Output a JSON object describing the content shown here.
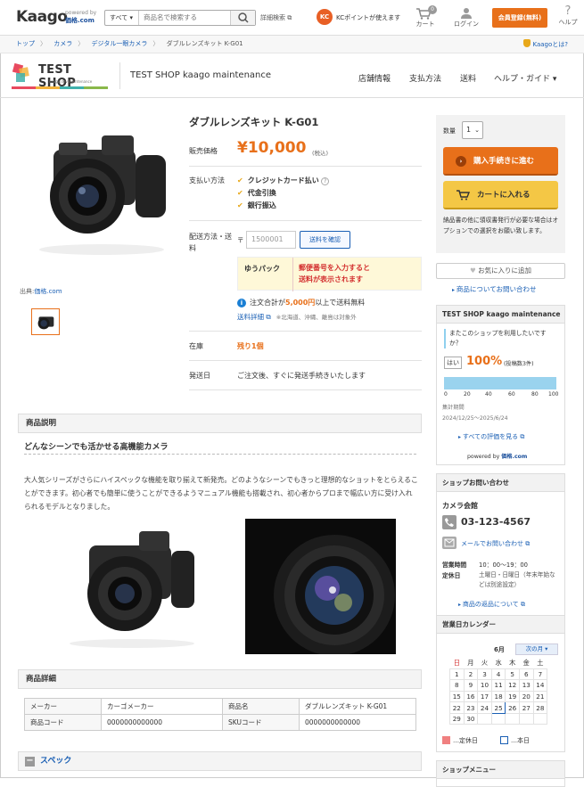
{
  "header": {
    "logo": "Kaago",
    "logo_powered": "powered by",
    "logo_brand": "価格.com",
    "search_category": "すべて ▾",
    "search_placeholder": "商品名で検索する",
    "advanced_search": "詳細検索",
    "kc_icon": "KC",
    "kc_points": "KCポイントが使えます",
    "cart_label": "カート",
    "cart_count": "0",
    "login_label": "ログイン",
    "register_label": "会員登録(無料)",
    "help_label": "ヘルプ"
  },
  "breadcrumb": [
    "トップ",
    "カメラ",
    "デジタル一眼カメラ",
    "ダブルレンズキット K-G01"
  ],
  "breadcrumb_sep": "〉",
  "kaago_about": "Kaagoとは?",
  "shop": {
    "logo_name": "TEST SHOP",
    "logo_sub": "kaago.dev maintenance",
    "name": "TEST SHOP kaago maintenance",
    "nav": [
      "店舗情報",
      "支払方法",
      "送料",
      "ヘルプ・ガイド ▾"
    ]
  },
  "product": {
    "title": "ダブルレンズキット K-G01",
    "price_label": "販売価格",
    "price": "¥10,000",
    "tax": "(税込)",
    "payment_label": "支払い方法",
    "payments": [
      "クレジットカード払い",
      "代金引換",
      "銀行振込"
    ],
    "shipping_label": "配送方法・送料",
    "zip_mark": "〒",
    "zip_placeholder": "1500001",
    "zip_button": "送料を確認",
    "carrier": "ゆうパック",
    "carrier_note_1": "郵便番号を入力すると",
    "carrier_note_2": "送料が表示されます",
    "free_notice_pre": "注文合計が",
    "free_notice_amount": "5,000円",
    "free_notice_post": "以上で送料無料",
    "shipping_detail": "送料詳細",
    "shipping_detail_note": "※北海道、沖縄、離島は対象外",
    "stock_label": "在庫",
    "stock_value": "残り1個",
    "ship_date_label": "発送日",
    "ship_date_value": "ご注文後、すぐに発送手続きいたします",
    "source_label": "出典:",
    "source_link": "価格.com"
  },
  "purchase": {
    "qty_label": "数量",
    "qty_value": "1",
    "buy_button": "購入手続きに進む",
    "cart_button": "カートに入れる",
    "note": "納品書の他に領収書発行が必要な場合はオプションでの選択をお願い致します。",
    "favorite": "お気に入りに追加",
    "inquiry": "商品についてお問い合わせ"
  },
  "rating": {
    "shop": "TEST SHOP kaago maintenance",
    "question": "またこのショップを利用したいですか？",
    "yes": "はい",
    "percent": "100%",
    "count": "(投稿数3件)",
    "scale": [
      "0",
      "20",
      "40",
      "60",
      "80",
      "100"
    ],
    "fill": 1.0,
    "period_label": "集計期間",
    "period": "2024/12/25〜2025/6/24",
    "all_reviews": "すべての評価を見る",
    "powered_by": "powered by",
    "powered_brand": "価格.com"
  },
  "contact": {
    "title": "ショップお問い合わせ",
    "company": "カメラ会館",
    "phone": "03-123-4567",
    "mail": "メールでお問い合わせ",
    "hours_label": "営業時間",
    "hours": "10：00〜19：00",
    "closed_label": "定休日",
    "closed": "土曜日・日曜日（年末年始などは別途設定）",
    "returns": "商品の返品について"
  },
  "calendar": {
    "title": "営業日カレンダー",
    "month": "6月",
    "next": "次の月 ▾",
    "weekdays": [
      "日",
      "月",
      "火",
      "水",
      "木",
      "金",
      "土"
    ],
    "weeks": [
      [
        "1",
        "2",
        "3",
        "4",
        "5",
        "6",
        "7"
      ],
      [
        "8",
        "9",
        "10",
        "11",
        "12",
        "13",
        "14"
      ],
      [
        "15",
        "16",
        "17",
        "18",
        "19",
        "20",
        "21"
      ],
      [
        "22",
        "23",
        "24",
        "25",
        "26",
        "27",
        "28"
      ],
      [
        "29",
        "30",
        "",
        "",
        "",
        "",
        ""
      ]
    ],
    "today": "25",
    "legend_holiday": "…定休日",
    "legend_today": "…本日",
    "holiday_color": "#f7d3d3",
    "today_color": "#1a5fb4"
  },
  "shop_menu": "ショップメニュー",
  "description": {
    "title": "商品説明",
    "subtitle": "どんなシーンでも活かせる高機能カメラ",
    "body": "大人気シリーズがさらにハイスペックな機能を取り揃えて新発売。どのようなシーンでもきっと理想的なショットをとらえることができます。初心者でも簡単に使うことができるようマニュアル機能も搭載され、初心者からプロまで幅広い方に受け入れられるモデルとなりました。"
  },
  "details": {
    "title": "商品詳細",
    "rows": [
      [
        "メーカー",
        "カーゴメーカー",
        "商品名",
        "ダブルレンズキット K-G01"
      ],
      [
        "商品コード",
        "0000000000000",
        "SKUコード",
        "0000000000000"
      ]
    ]
  },
  "spec_title": "スペック",
  "colors": {
    "accent": "#e8701a",
    "link": "#1a5fb4",
    "cart_yellow": "#f4c745",
    "alert_red": "#d32f2f"
  }
}
